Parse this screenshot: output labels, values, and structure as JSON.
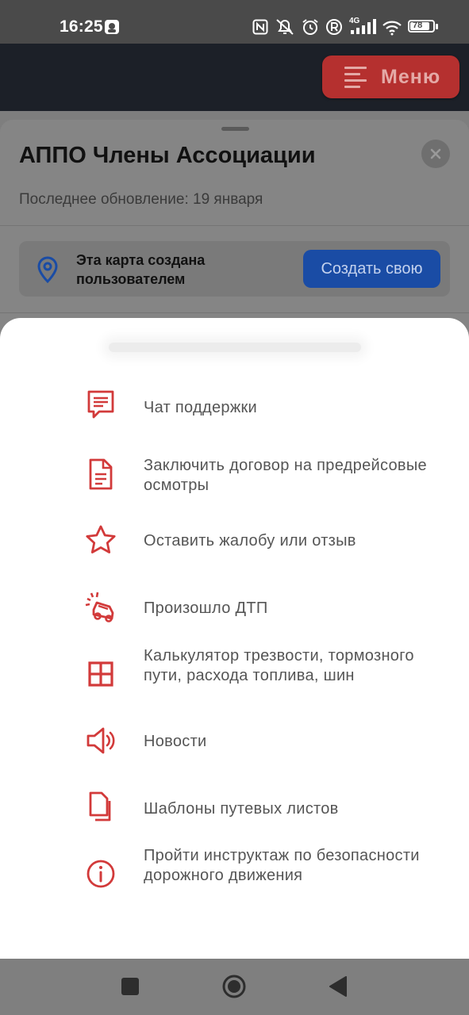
{
  "status_bar": {
    "time": "16:25",
    "battery": "78",
    "network": "4G"
  },
  "header": {
    "menu_label": "Меню"
  },
  "card": {
    "title": "АППО Члены Ассоциации",
    "subtitle": "Последнее обновление: 19 января",
    "info_text": "Эта карта создана пользователем",
    "create_button": "Создать свою"
  },
  "menu": {
    "items": [
      {
        "label": "Чат поддержки",
        "icon": "chat-icon"
      },
      {
        "label": "Заключить договор  на предрейсовые осмотры",
        "icon": "document-icon"
      },
      {
        "label": "Оставить жалобу или отзыв",
        "icon": "star-icon"
      },
      {
        "label": "Произошло ДТП",
        "icon": "car-crash-icon"
      },
      {
        "label": "Калькулятор трезвости, тормозного пути, расхода  топлива, шин",
        "icon": "grid-icon"
      },
      {
        "label": "Новости",
        "icon": "speaker-icon"
      },
      {
        "label": "Шаблоны путевых листов",
        "icon": "copy-icon"
      },
      {
        "label": "Пройти инструктаж по безопасности дорожного движения",
        "icon": "info-icon"
      }
    ]
  },
  "colors": {
    "accent": "#d23a3a",
    "button_blue": "#1a4ca5",
    "menu_red": "#b5302f"
  }
}
